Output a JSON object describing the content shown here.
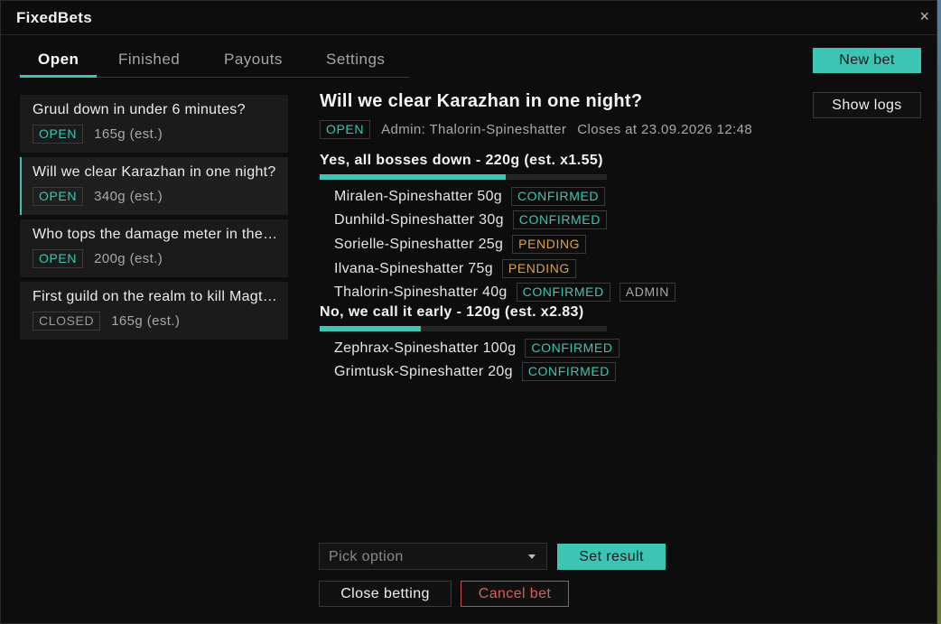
{
  "window": {
    "title": "FixedBets",
    "close_glyph": "×"
  },
  "tabs": [
    {
      "label": "Open"
    },
    {
      "label": "Finished"
    },
    {
      "label": "Payouts"
    },
    {
      "label": "Settings"
    }
  ],
  "actions": {
    "new_bet": "New bet",
    "show_logs": "Show logs"
  },
  "bets": [
    {
      "question": "Gruul down in under 6 minutes?",
      "status": "OPEN",
      "amount": "165g (est.)"
    },
    {
      "question": "Will we clear Karazhan in one night?",
      "status": "OPEN",
      "amount": "340g (est.)"
    },
    {
      "question": "Who tops the damage meter in the raid tonight?",
      "status": "OPEN",
      "amount": "200g (est.)"
    },
    {
      "question": "First guild on the realm to kill Magtheridon?",
      "status": "CLOSED",
      "amount": "165g (est.)"
    }
  ],
  "detail": {
    "title": "Will we clear Karazhan in one night?",
    "status": "OPEN",
    "admin": "Admin: Thalorin-Spineshatter",
    "closes": "Closes at 23.09.2026 12:48",
    "options": [
      {
        "label": "Yes, all bosses down - 220g (est. x1.55)",
        "share": 0.647,
        "entries": [
          {
            "name": "Miralen-Spineshatter 50g",
            "badges": [
              "CONFIRMED"
            ]
          },
          {
            "name": "Dunhild-Spineshatter 30g",
            "badges": [
              "CONFIRMED"
            ]
          },
          {
            "name": "Sorielle-Spineshatter 25g",
            "badges": [
              "PENDING"
            ]
          },
          {
            "name": "Ilvana-Spineshatter 75g",
            "badges": [
              "PENDING"
            ]
          },
          {
            "name": "Thalorin-Spineshatter 40g",
            "badges": [
              "CONFIRMED",
              "ADMIN"
            ]
          }
        ]
      },
      {
        "label": "No, we call it early - 120g (est. x2.83)",
        "share": 0.353,
        "entries": [
          {
            "name": "Zephrax-Spineshatter 100g",
            "badges": [
              "CONFIRMED"
            ]
          },
          {
            "name": "Grimtusk-Spineshatter 20g",
            "badges": [
              "CONFIRMED"
            ]
          }
        ]
      }
    ]
  },
  "controls": {
    "pick_option_placeholder": "Pick option",
    "set_result": "Set result",
    "close_betting": "Close betting",
    "cancel_bet": "Cancel bet"
  },
  "colors": {
    "accent": "#3cc4b4",
    "pending": "#d9a24a",
    "danger": "#e05a5a",
    "background": "#0d0d0d"
  }
}
